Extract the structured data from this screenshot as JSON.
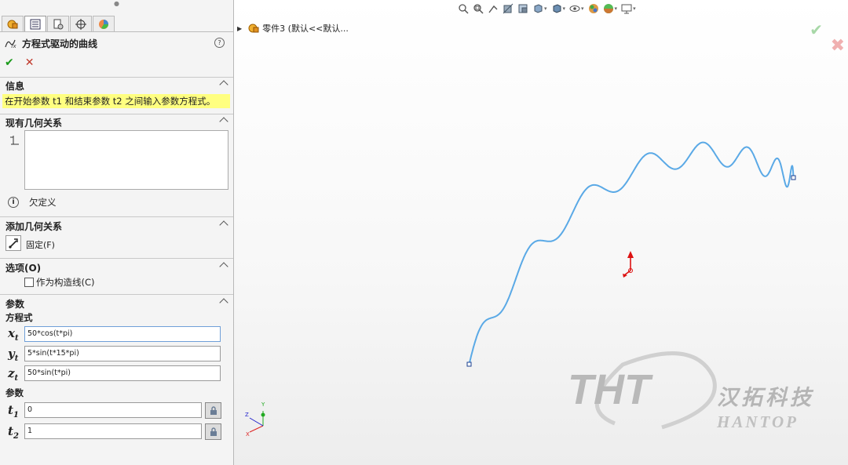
{
  "feature": {
    "title": "方程式驱动的曲线",
    "help": "?"
  },
  "info": {
    "header": "信息",
    "message": "在开始参数 t1 和结束参数 t2 之间输入参数方程式。"
  },
  "existing_relations": {
    "header": "现有几何关系",
    "status": "欠定义"
  },
  "add_relations": {
    "header": "添加几何关系",
    "fix_label": "固定(F)"
  },
  "options": {
    "header": "选项(O)",
    "construction_label": "作为构造线(C)",
    "construction_checked": false
  },
  "params": {
    "header": "参数",
    "equation_label": "方程式",
    "xt": "50*cos(t*pi)",
    "yt": "5*sin(t*15*pi)",
    "zt": "50*sin(t*pi)",
    "param_label": "参数",
    "t1": "0",
    "t2": "1"
  },
  "tree": {
    "item": "零件3  (默认<<默认..."
  },
  "watermark": {
    "logo": "THT",
    "cn": "汉拓科技",
    "en": "HANTOP"
  },
  "triad": {
    "x": "X",
    "y": "Y",
    "z": "Z"
  },
  "colors": {
    "curve": "#5aa9e6",
    "info_highlight": "#ffff80",
    "accept": "#1a9a1a",
    "reject": "#c0392b"
  }
}
